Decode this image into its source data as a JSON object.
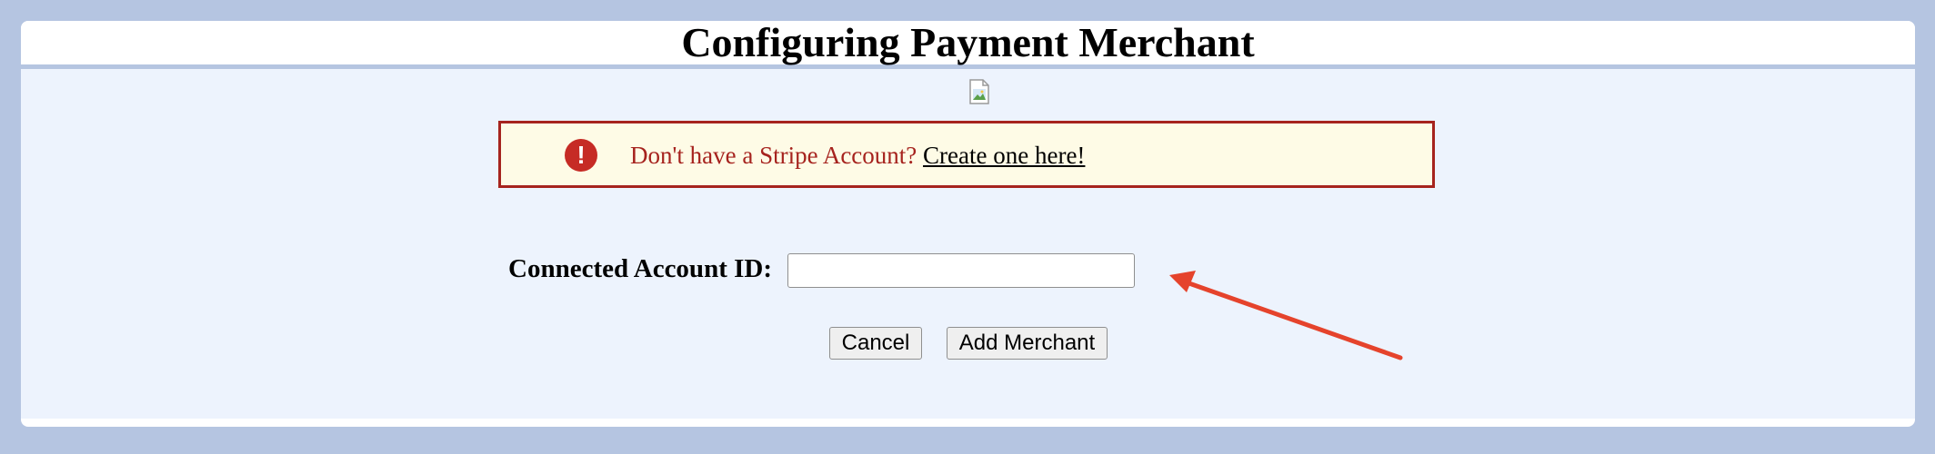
{
  "page": {
    "title": "Configuring Payment Merchant"
  },
  "alert": {
    "icon": "exclamation-circle-icon",
    "message": "Don't have a Stripe Account?",
    "link_text": "Create one here!"
  },
  "form": {
    "account_label": "Connected Account ID:",
    "account_value": "",
    "cancel_label": "Cancel",
    "submit_label": "Add Merchant"
  },
  "colors": {
    "background": "#b5c5e1",
    "content": "#edf3fd",
    "alert_border": "#a6231e",
    "alert_background": "#fefbe6",
    "annotation_arrow": "#e5432c"
  }
}
